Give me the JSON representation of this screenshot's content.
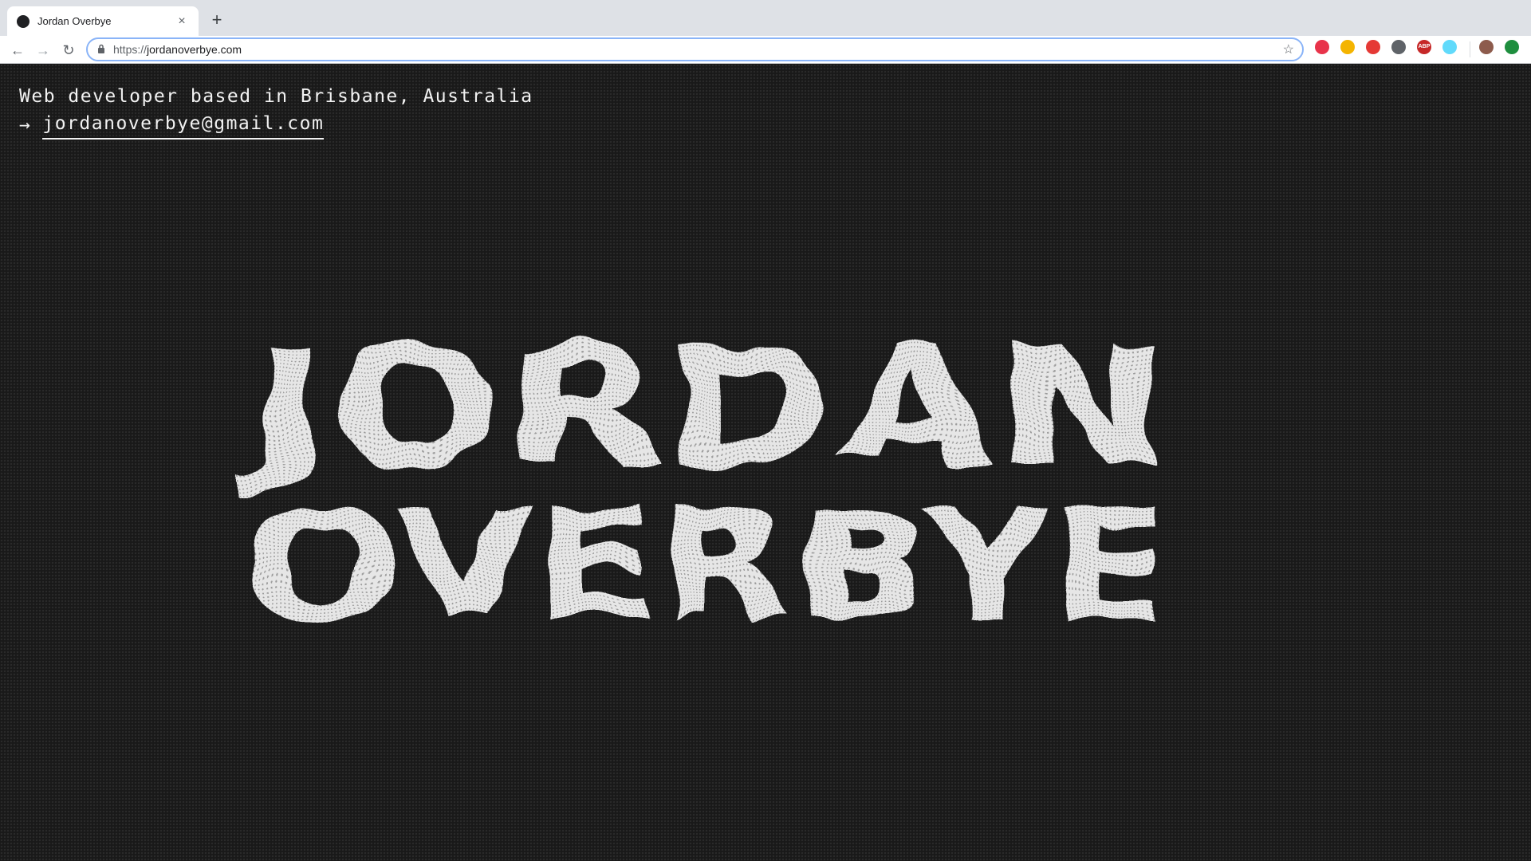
{
  "browser": {
    "tab_title": "Jordan Overbye",
    "tab_close": "×",
    "new_tab": "+",
    "url_scheme": "https://",
    "url_host": "jordanoverbye.com",
    "nav": {
      "back": "←",
      "forward": "→",
      "reload": "↻"
    },
    "extensions": [
      {
        "name": "grammar-extension-icon",
        "color": "#e8334a"
      },
      {
        "name": "color-picker-extension-icon",
        "color": "#f4b400"
      },
      {
        "name": "shield-extension-icon",
        "color": "#e53935"
      },
      {
        "name": "spiral-extension-icon",
        "color": "#5f6368"
      },
      {
        "name": "adblock-extension-icon",
        "color": "#c62828",
        "label": "ABP"
      },
      {
        "name": "react-devtools-extension-icon",
        "color": "#61dafb"
      },
      {
        "name": "profile-avatar-icon",
        "color": "#8d5b4c"
      },
      {
        "name": "update-extension-icon",
        "color": "#1e8e3e"
      }
    ]
  },
  "page": {
    "intro": "Web developer based in Brisbane, Australia",
    "arrow": "→",
    "email": "jordanoverbye@gmail.com",
    "logo_lines": [
      "JORDAN",
      "OVERBYE"
    ],
    "accent_color": "#e6e6e6"
  }
}
